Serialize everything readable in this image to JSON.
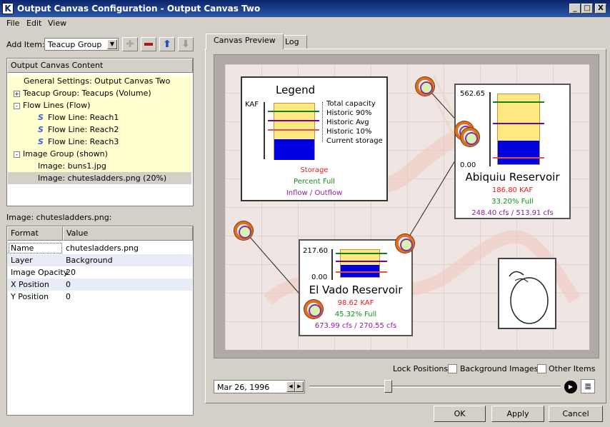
{
  "window": {
    "title": "Output Canvas Configuration - Output Canvas Two",
    "min": "_",
    "max": "□",
    "close": "X"
  },
  "menu": [
    "File",
    "Edit",
    "View"
  ],
  "add_item": {
    "label": "Add Item:",
    "value": "Teacup Group"
  },
  "content_panel": {
    "header": "Output Canvas Content"
  },
  "tree": [
    {
      "text": "General Settings: Output Canvas Two",
      "indent": 0,
      "toggle": "",
      "icon": ""
    },
    {
      "text": "Teacup Group: Teacups (Volume)",
      "indent": 0,
      "toggle": "+",
      "icon": ""
    },
    {
      "text": "Flow Lines (Flow)",
      "indent": 0,
      "toggle": "-",
      "icon": ""
    },
    {
      "text": "Flow Line: Reach1",
      "indent": 1,
      "toggle": "",
      "icon": "flow-line"
    },
    {
      "text": "Flow Line: Reach2",
      "indent": 1,
      "toggle": "",
      "icon": "flow-line"
    },
    {
      "text": "Flow Line: Reach3",
      "indent": 1,
      "toggle": "",
      "icon": "flow-line"
    },
    {
      "text": "Image Group (shown)",
      "indent": 0,
      "toggle": "-",
      "icon": ""
    },
    {
      "text": "Image: buns1.jpg",
      "indent": 1,
      "toggle": "",
      "icon": ""
    },
    {
      "text": "Image: chutesladders.png (20%)",
      "indent": 1,
      "toggle": "",
      "icon": "",
      "selected": true
    }
  ],
  "selection_label": "Image: chutesladders.png:",
  "props": {
    "col_format": "Format",
    "col_value": "Value",
    "rows": [
      {
        "k": "Name",
        "v": "chutesladders.png"
      },
      {
        "k": "Layer",
        "v": "Background"
      },
      {
        "k": "Image Opacity",
        "v": "20"
      },
      {
        "k": "X Position",
        "v": "0"
      },
      {
        "k": "Y Position",
        "v": "0"
      }
    ]
  },
  "tabs": {
    "preview": "Canvas Preview",
    "log": "Log"
  },
  "legend": {
    "title": "Legend",
    "unit": "KAF",
    "items": [
      "Total capacity",
      "Historic 90%",
      "Historic Avg",
      "Historic 10%",
      "Current storage"
    ],
    "storage": "Storage",
    "pct": "Percent Full",
    "flow": "Inflow / Outflow"
  },
  "abiquiu": {
    "max": "562.65",
    "min": "0.00",
    "name": "Abiquiu Reservoir",
    "storage": "186.80 KAF",
    "pct": "33.20% Full",
    "flow": "248.40 cfs / 513.91 cfs",
    "fill": 0.332
  },
  "elvado": {
    "max": "217.60",
    "min": "0.00",
    "name": "El Vado Reservoir",
    "storage": "98.62 KAF",
    "pct": "45.32% Full",
    "flow": "673.99 cfs / 270.55 cfs",
    "fill": 0.4532
  },
  "lock": {
    "label": "Lock Positions:",
    "bg": "Background Images",
    "other": "Other Items"
  },
  "date": "Mar 26, 1996",
  "buttons": {
    "ok": "OK",
    "apply": "Apply",
    "cancel": "Cancel"
  },
  "colors": {
    "storage": "#e02020",
    "pct": "#10901a",
    "flow": "#901aa0",
    "historic90": "#108010",
    "avg": "#800080",
    "historic10": "#e05050",
    "fill": "#0000e0",
    "capacity": "#ffe880"
  }
}
